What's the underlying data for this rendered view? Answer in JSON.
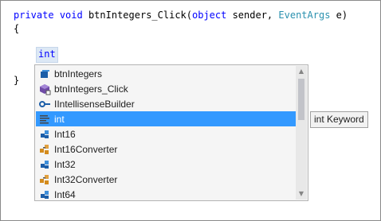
{
  "code": {
    "line1_private": "private",
    "line1_void": "void",
    "line1_method": " btnIntegers_Click(",
    "line1_object": "object",
    "line1_sender": " sender, ",
    "line1_eventargs": "EventArgs",
    "line1_end": " e)",
    "line2": "{",
    "typed": "int",
    "line_close": "}"
  },
  "completion": {
    "items": [
      {
        "label": "btnIntegers",
        "icon": "field-icon"
      },
      {
        "label": "btnIntegers_Click",
        "icon": "method-icon"
      },
      {
        "label": "IIntellisenseBuilder",
        "icon": "interface-icon"
      },
      {
        "label": "int",
        "icon": "keyword-icon"
      },
      {
        "label": "Int16",
        "icon": "struct-icon"
      },
      {
        "label": "Int16Converter",
        "icon": "class-icon"
      },
      {
        "label": "Int32",
        "icon": "struct-icon"
      },
      {
        "label": "Int32Converter",
        "icon": "class-icon"
      },
      {
        "label": "Int64",
        "icon": "struct-icon"
      }
    ],
    "selected_index": 3,
    "tooltip": "int Keyword"
  },
  "colors": {
    "selection": "#3399ff",
    "keyword": "#0000ff",
    "type": "#2b91af"
  }
}
